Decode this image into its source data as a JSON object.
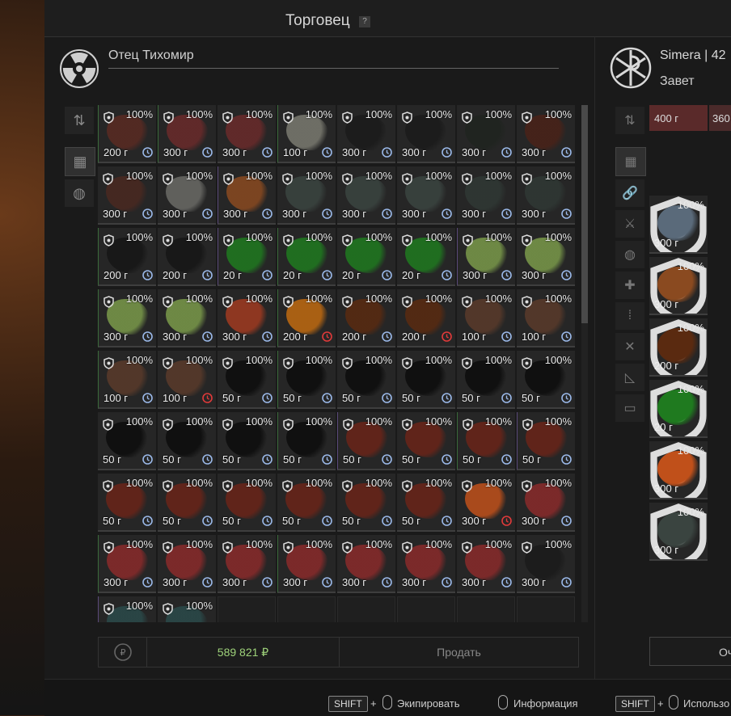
{
  "window": {
    "title": "Торговец",
    "help": "?"
  },
  "trader": {
    "name": "Отец Тихомир"
  },
  "player": {
    "name": "Simera | 42",
    "faction": "Завет"
  },
  "grid": {
    "percent": "100%",
    "cols": 8,
    "items": [
      {
        "price": "200 г",
        "art": "#5a2a22",
        "frame": "green",
        "clock": "normal"
      },
      {
        "price": "300 г",
        "art": "#6a2a2a",
        "frame": "green",
        "clock": "normal"
      },
      {
        "price": "300 г",
        "art": "#6a2a2a",
        "frame": "",
        "clock": "normal"
      },
      {
        "price": "100 г",
        "art": "#7a7a70",
        "frame": "green",
        "clock": "normal"
      },
      {
        "price": "300 г",
        "art": "#1a1a1a",
        "frame": "",
        "clock": "normal"
      },
      {
        "price": "300 г",
        "art": "#1a1a1a",
        "frame": "",
        "clock": "normal"
      },
      {
        "price": "300 г",
        "art": "#1f241f",
        "frame": "",
        "clock": "normal"
      },
      {
        "price": "300 г",
        "art": "#4a2218",
        "frame": "",
        "clock": "normal"
      },
      {
        "price": "300 г",
        "art": "#4a2820",
        "frame": "",
        "clock": "normal"
      },
      {
        "price": "300 г",
        "art": "#6a6a66",
        "frame": "",
        "clock": "normal"
      },
      {
        "price": "300 г",
        "art": "#8a4a20",
        "frame": "purple",
        "clock": "normal"
      },
      {
        "price": "300 г",
        "art": "#3a4440",
        "frame": "",
        "clock": "normal"
      },
      {
        "price": "300 г",
        "art": "#3a4440",
        "frame": "",
        "clock": "normal"
      },
      {
        "price": "300 г",
        "art": "#3a4440",
        "frame": "",
        "clock": "normal"
      },
      {
        "price": "300 г",
        "art": "#2f3834",
        "frame": "",
        "clock": "normal"
      },
      {
        "price": "300 г",
        "art": "#2f3834",
        "frame": "",
        "clock": "normal"
      },
      {
        "price": "200 г",
        "art": "#151515",
        "frame": "green",
        "clock": "normal"
      },
      {
        "price": "200 г",
        "art": "#151515",
        "frame": "",
        "clock": "normal"
      },
      {
        "price": "20 г",
        "art": "#1f7a1f",
        "frame": "purple",
        "clock": "normal"
      },
      {
        "price": "20 г",
        "art": "#1f7a1f",
        "frame": "green",
        "clock": "normal"
      },
      {
        "price": "20 г",
        "art": "#1f7a1f",
        "frame": "",
        "clock": "normal"
      },
      {
        "price": "20 г",
        "art": "#1f7a1f",
        "frame": "",
        "clock": "normal"
      },
      {
        "price": "300 г",
        "art": "#7a9a4a",
        "frame": "purple",
        "clock": "normal"
      },
      {
        "price": "300 г",
        "art": "#7a9a4a",
        "frame": "",
        "clock": "normal"
      },
      {
        "price": "300 г",
        "art": "#7a9a4a",
        "frame": "green",
        "clock": "normal"
      },
      {
        "price": "300 г",
        "art": "#7a9a4a",
        "frame": "",
        "clock": "normal"
      },
      {
        "price": "300 г",
        "art": "#a03a20",
        "frame": "",
        "clock": "normal"
      },
      {
        "price": "200 г",
        "art": "#c06a10",
        "frame": "green",
        "clock": "red"
      },
      {
        "price": "200 г",
        "art": "#5a2a10",
        "frame": "",
        "clock": "normal"
      },
      {
        "price": "200 г",
        "art": "#5a2a10",
        "frame": "",
        "clock": "red"
      },
      {
        "price": "100 г",
        "art": "#5a3a2a",
        "frame": "",
        "clock": "normal"
      },
      {
        "price": "100 г",
        "art": "#5a3a2a",
        "frame": "",
        "clock": "normal"
      },
      {
        "price": "100 г",
        "art": "#5a3a2a",
        "frame": "green",
        "clock": "normal"
      },
      {
        "price": "100 г",
        "art": "#5a3a2a",
        "frame": "",
        "clock": "red"
      },
      {
        "price": "50 г",
        "art": "#0c0c0c",
        "frame": "",
        "clock": "normal"
      },
      {
        "price": "50 г",
        "art": "#0c0c0c",
        "frame": "green",
        "clock": "normal"
      },
      {
        "price": "50 г",
        "art": "#0c0c0c",
        "frame": "",
        "clock": "normal"
      },
      {
        "price": "50 г",
        "art": "#0c0c0c",
        "frame": "",
        "clock": "normal"
      },
      {
        "price": "50 г",
        "art": "#0c0c0c",
        "frame": "",
        "clock": "normal"
      },
      {
        "price": "50 г",
        "art": "#0c0c0c",
        "frame": "",
        "clock": "normal"
      },
      {
        "price": "50 г",
        "art": "#0c0c0c",
        "frame": "",
        "clock": "normal"
      },
      {
        "price": "50 г",
        "art": "#0c0c0c",
        "frame": "",
        "clock": "normal"
      },
      {
        "price": "50 г",
        "art": "#0c0c0c",
        "frame": "",
        "clock": "normal"
      },
      {
        "price": "50 г",
        "art": "#0c0c0c",
        "frame": "green",
        "clock": "normal"
      },
      {
        "price": "50 г",
        "art": "#6a2418",
        "frame": "purple",
        "clock": "normal"
      },
      {
        "price": "50 г",
        "art": "#6a2418",
        "frame": "",
        "clock": "normal"
      },
      {
        "price": "50 г",
        "art": "#6a2418",
        "frame": "green",
        "clock": "normal"
      },
      {
        "price": "50 г",
        "art": "#6a2418",
        "frame": "purple",
        "clock": "normal"
      },
      {
        "price": "50 г",
        "art": "#6a2418",
        "frame": "",
        "clock": "normal"
      },
      {
        "price": "50 г",
        "art": "#6a2418",
        "frame": "",
        "clock": "normal"
      },
      {
        "price": "50 г",
        "art": "#6a2418",
        "frame": "",
        "clock": "normal"
      },
      {
        "price": "50 г",
        "art": "#6a2418",
        "frame": "",
        "clock": "normal"
      },
      {
        "price": "50 г",
        "art": "#6a2418",
        "frame": "",
        "clock": "normal"
      },
      {
        "price": "50 г",
        "art": "#6a2418",
        "frame": "",
        "clock": "normal"
      },
      {
        "price": "300 г",
        "art": "#c0501a",
        "frame": "",
        "clock": "red"
      },
      {
        "price": "300 г",
        "art": "#8a2a2a",
        "frame": "",
        "clock": "normal"
      },
      {
        "price": "300 г",
        "art": "#8a2a2a",
        "frame": "green",
        "clock": "normal"
      },
      {
        "price": "300 г",
        "art": "#8a2a2a",
        "frame": "",
        "clock": "normal"
      },
      {
        "price": "300 г",
        "art": "#8a2a2a",
        "frame": "",
        "clock": "normal"
      },
      {
        "price": "300 г",
        "art": "#8a2a2a",
        "frame": "green",
        "clock": "normal"
      },
      {
        "price": "300 г",
        "art": "#8a2a2a",
        "frame": "",
        "clock": "normal"
      },
      {
        "price": "300 г",
        "art": "#8a2a2a",
        "frame": "",
        "clock": "normal"
      },
      {
        "price": "300 г",
        "art": "#8a2a2a",
        "frame": "",
        "clock": "normal"
      },
      {
        "price": "300 г",
        "art": "#1a1a1a",
        "frame": "",
        "clock": "normal"
      },
      {
        "price": "",
        "art": "#2a4a4a",
        "frame": "purple",
        "clock": "none"
      },
      {
        "price": "",
        "art": "#2a4a4a",
        "frame": "",
        "clock": "none"
      }
    ]
  },
  "sidebar_left": [
    {
      "name": "sort-icon",
      "symbol": "⇅"
    },
    {
      "name": "grid-view-icon",
      "symbol": "▦"
    },
    {
      "name": "artifact-filter-icon",
      "symbol": "◍"
    }
  ],
  "sidebar_right": [
    {
      "name": "sort-icon",
      "symbol": "⇅"
    },
    {
      "name": "grid-view-icon",
      "symbol": "▦"
    },
    {
      "name": "link-icon",
      "symbol": "🔗"
    },
    {
      "name": "weapon-icon",
      "symbol": "⚔"
    },
    {
      "name": "artifact-filter-icon",
      "symbol": "◍"
    },
    {
      "name": "medkit-icon",
      "symbol": "✚"
    },
    {
      "name": "ammo-icon",
      "symbol": "⁞"
    },
    {
      "name": "tools-icon",
      "symbol": "✕"
    },
    {
      "name": "blueprint-icon",
      "symbol": "◺"
    },
    {
      "name": "container-icon",
      "symbol": "▭"
    }
  ],
  "right_grid": {
    "top_prices": [
      "400 г",
      "360"
    ],
    "items": [
      {
        "price": "300 г",
        "art": "#5a6a7a",
        "clock": "normal"
      },
      {
        "price": "300 г",
        "art": "#8a4a20",
        "clock": "normal"
      },
      {
        "price": "200 г",
        "art": "#5a2a10",
        "clock": "normal"
      },
      {
        "price": "20 г",
        "art": "#1f7a1f",
        "clock": "normal"
      },
      {
        "price": "300 г",
        "art": "#c0501a",
        "clock": "red"
      },
      {
        "price": "300 г",
        "art": "#3a4440",
        "clock": "normal"
      }
    ]
  },
  "money": "589 821 ₽",
  "sell_label": "Продать",
  "right_button": "Оч",
  "footer": {
    "shift": "SHIFT",
    "plus": "+",
    "equip": "Экипировать",
    "info": "Информация",
    "use": "Использо"
  },
  "colors": {
    "accent_green": "#9ed27a",
    "clock_normal": "#9ab8e8",
    "clock_red": "#e03a3a"
  }
}
